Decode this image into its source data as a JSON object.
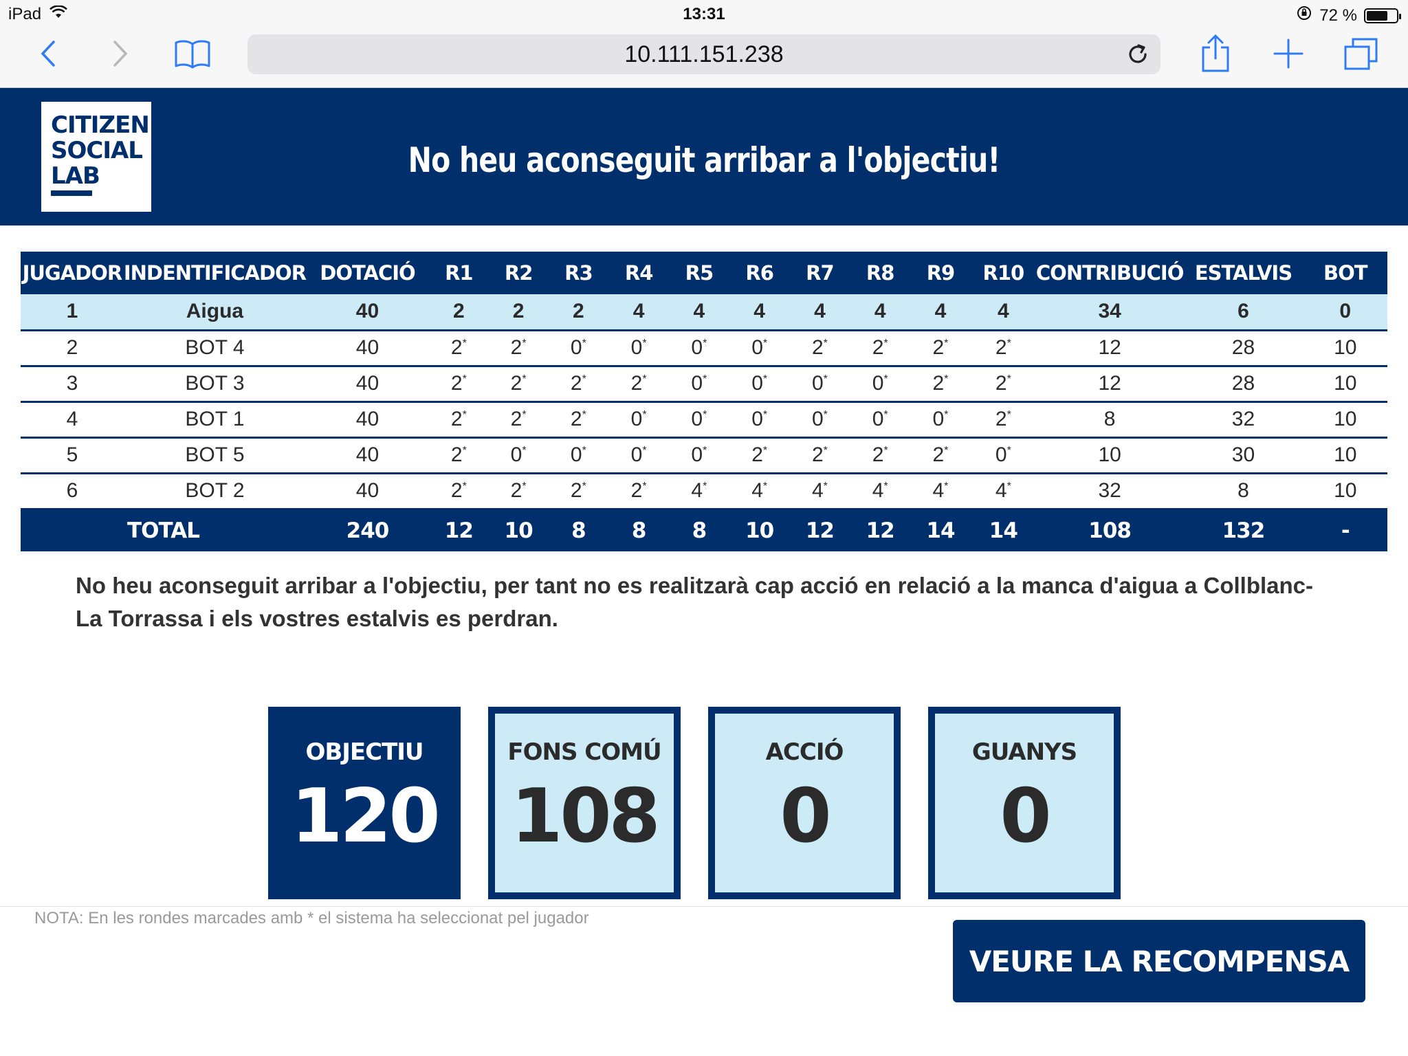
{
  "status_bar": {
    "device": "iPad",
    "time": "13:31",
    "battery": "72 %",
    "battery_level": 0.72
  },
  "browser": {
    "url": "10.111.151.238"
  },
  "header": {
    "logo_lines": [
      "CITIZEN",
      "SOCIAL",
      "LAB"
    ],
    "title": "No heu aconseguit arribar a l'objectiu!"
  },
  "table": {
    "columns": [
      "JUGADOR",
      "INDENTIFICADOR",
      "DOTACIÓ",
      "R1",
      "R2",
      "R3",
      "R4",
      "R5",
      "R6",
      "R7",
      "R8",
      "R9",
      "R10",
      "CONTRIBUCIÓ",
      "ESTALVIS",
      "BOT"
    ],
    "rows": [
      {
        "player": "1",
        "id": "Aigua",
        "dotacio": "40",
        "rounds": [
          "2",
          "2",
          "2",
          "4",
          "4",
          "4",
          "4",
          "4",
          "4",
          "4"
        ],
        "starred": false,
        "contribucio": "34",
        "estalvis": "6",
        "bot": "0",
        "highlight": true
      },
      {
        "player": "2",
        "id": "BOT 4",
        "dotacio": "40",
        "rounds": [
          "2",
          "2",
          "0",
          "0",
          "0",
          "0",
          "2",
          "2",
          "2",
          "2"
        ],
        "starred": true,
        "contribucio": "12",
        "estalvis": "28",
        "bot": "10",
        "highlight": false
      },
      {
        "player": "3",
        "id": "BOT 3",
        "dotacio": "40",
        "rounds": [
          "2",
          "2",
          "2",
          "2",
          "0",
          "0",
          "0",
          "0",
          "2",
          "2"
        ],
        "starred": true,
        "contribucio": "12",
        "estalvis": "28",
        "bot": "10",
        "highlight": false
      },
      {
        "player": "4",
        "id": "BOT 1",
        "dotacio": "40",
        "rounds": [
          "2",
          "2",
          "2",
          "0",
          "0",
          "0",
          "0",
          "0",
          "0",
          "2"
        ],
        "starred": true,
        "contribucio": "8",
        "estalvis": "32",
        "bot": "10",
        "highlight": false
      },
      {
        "player": "5",
        "id": "BOT 5",
        "dotacio": "40",
        "rounds": [
          "2",
          "0",
          "0",
          "0",
          "0",
          "2",
          "2",
          "2",
          "2",
          "0"
        ],
        "starred": true,
        "contribucio": "10",
        "estalvis": "30",
        "bot": "10",
        "highlight": false
      },
      {
        "player": "6",
        "id": "BOT 2",
        "dotacio": "40",
        "rounds": [
          "2",
          "2",
          "2",
          "2",
          "4",
          "4",
          "4",
          "4",
          "4",
          "4"
        ],
        "starred": true,
        "contribucio": "32",
        "estalvis": "8",
        "bot": "10",
        "highlight": false
      }
    ],
    "total": {
      "label": "TOTAL",
      "dotacio": "240",
      "rounds": [
        "12",
        "10",
        "8",
        "8",
        "8",
        "10",
        "12",
        "12",
        "14",
        "14"
      ],
      "contribucio": "108",
      "estalvis": "132",
      "bot": "-"
    },
    "star": "*"
  },
  "message": "No heu aconseguit arribar a l'objectiu, per tant no es realitzarà cap acció en relació a la manca d'aigua a Collblanc-La Torrassa i els vostres estalvis es perdran.",
  "cards": [
    {
      "label": "OBJECTIU",
      "value": "120",
      "dark": true
    },
    {
      "label": "FONS COMÚ",
      "value": "108",
      "dark": false
    },
    {
      "label": "ACCIÓ",
      "value": "0",
      "dark": false
    },
    {
      "label": "GUANYS",
      "value": "0",
      "dark": false
    }
  ],
  "note": "NOTA: En les rondes marcades amb * el sistema ha seleccionat pel jugador",
  "reward_button": "VEURE LA RECOMPENSA"
}
